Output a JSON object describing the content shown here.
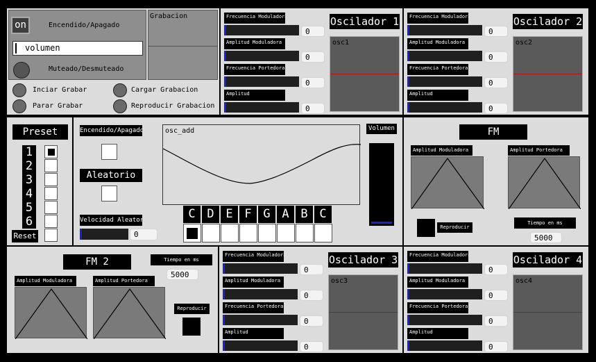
{
  "top_left": {
    "on_button": "on",
    "power_label": "Encendido/Apagado",
    "volume_field": "volumen",
    "mute_label": "Muteado/Desmuteado",
    "recording_title": "Grabacion",
    "rec_buttons": [
      "Inciar Grabar",
      "Parar Grabar",
      "Cargar Grabacion",
      "Reproducir Grabacion"
    ]
  },
  "osc1": {
    "title": "Oscilador 1",
    "scope_label": "osc1",
    "sliders": [
      {
        "label": "Frecuencia Moduladora",
        "value": "0"
      },
      {
        "label": "Amplitud Moduladora",
        "value": "0"
      },
      {
        "label": "Frecuencia Portedora",
        "value": "0"
      },
      {
        "label": "Amplitud",
        "value": "0"
      }
    ]
  },
  "osc2": {
    "title": "Oscilador 2",
    "scope_label": "osc2",
    "sliders": [
      {
        "label": "Frecuencia Moduladora",
        "value": "0"
      },
      {
        "label": "Amplitud Moduladora",
        "value": "0"
      },
      {
        "label": "Frecuencia Portedora",
        "value": "0"
      },
      {
        "label": "Amplitud",
        "value": "0"
      }
    ]
  },
  "osc3": {
    "title": "Oscilador 3",
    "scope_label": "osc3",
    "sliders": [
      {
        "label": "Frecuencia Moduladora",
        "value": "0"
      },
      {
        "label": "Amplitud Moduladora",
        "value": "0"
      },
      {
        "label": "Frecuencia Portedora",
        "value": "0"
      },
      {
        "label": "Amplitud",
        "value": "0"
      }
    ]
  },
  "osc4": {
    "title": "Oscilador 4",
    "scope_label": "osc4",
    "sliders": [
      {
        "label": "Frecuencia Moduladora",
        "value": "0"
      },
      {
        "label": "Amplitud Moduladora",
        "value": "0"
      },
      {
        "label": "Frecuencia Portedora",
        "value": "0"
      },
      {
        "label": "Amplitud",
        "value": "0"
      }
    ]
  },
  "preset": {
    "title": "Preset",
    "numbers": [
      "1",
      "2",
      "3",
      "4",
      "5",
      "6"
    ],
    "reset": "Reset",
    "selected_index": 0
  },
  "mid": {
    "power_label": "Encendido/Apagado",
    "random_label": "Aleatorio",
    "random_speed_label": "Velocidad Aleatorio",
    "random_speed_value": "0",
    "scope_label": "osc_add",
    "notes": [
      "C",
      "D",
      "E",
      "F",
      "G",
      "A",
      "B",
      "C"
    ],
    "selected_note_index": 0,
    "volume_label": "Volumen"
  },
  "fm": {
    "title": "FM",
    "amp_mod_label": "Amplitud Moduladora",
    "amp_port_label": "Amplitud Portedora",
    "play_label": "Reproducir",
    "time_label": "Tiempo en ms",
    "time_value": "5000"
  },
  "fm2": {
    "title": "FM 2",
    "amp_mod_label": "Amplitud Moduladora",
    "amp_port_label": "Amplitud Portedora",
    "play_label": "Reproducir",
    "time_label": "Tiempo en ms",
    "time_value": "5000"
  }
}
